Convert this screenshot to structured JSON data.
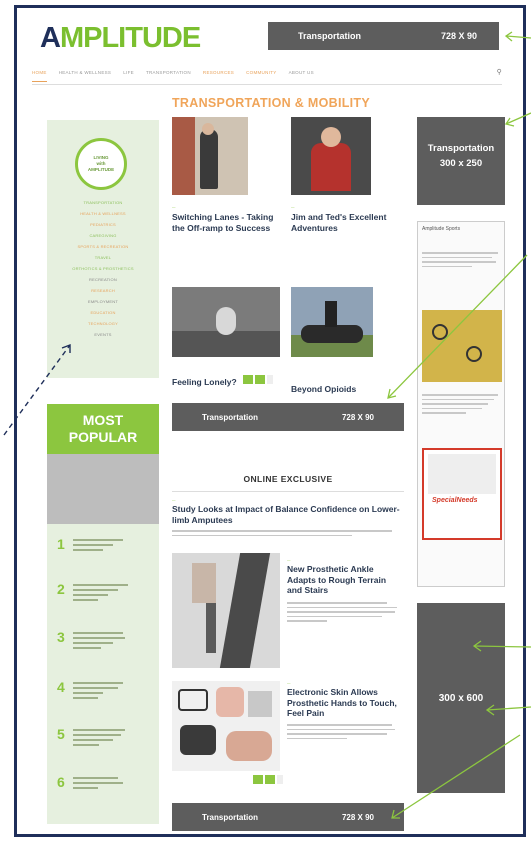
{
  "header": {
    "logo_prefix": "A",
    "logo_rest": "MPLITUDE",
    "ad_top": {
      "label": "Transportation",
      "size": "728 X 90"
    }
  },
  "nav": {
    "items": [
      "HOME",
      "HEALTH & WELLNESS",
      "LIFE",
      "TRANSPORTATION",
      "RESOURCES",
      "COMMUNITY",
      "ABOUT US"
    ],
    "search_icon": "search-icon"
  },
  "section_title": "TRANSPORTATION & MOBILITY",
  "side_menu": {
    "logo_text": [
      "LIVING",
      "with",
      "AMPLITUDE"
    ],
    "items": [
      "TRANSPORTATION",
      "HEALTH & WELLNESS",
      "PEDIATRICS",
      "CAREGIVING",
      "SPORTS & RECREATION",
      "TRAVEL",
      "ORTHOTICS & PROSTHETICS",
      "RECREATION",
      "RESEARCH",
      "EMPLOYMENT",
      "EDUCATION",
      "TECHNOLOGY",
      "EVENTS"
    ]
  },
  "most_popular": {
    "title_line1": "MOST",
    "title_line2": "POPULAR",
    "numbers": [
      "1",
      "2",
      "3",
      "4",
      "5",
      "6"
    ]
  },
  "posts": [
    {
      "title": "Switching Lanes - Taking the Off-ramp to Success"
    },
    {
      "title": "Jim and Ted's Excellent Adventures"
    },
    {
      "title": "Feeling Lonely?"
    },
    {
      "title": "Beyond Opioids"
    }
  ],
  "ad_mid": {
    "label": "Transportation",
    "size": "728 X 90"
  },
  "online_exclusive": {
    "heading": "ONLINE EXCLUSIVE",
    "lead_title": "Study Looks at Impact of Balance Confidence on Lower-limb Amputees",
    "items": [
      {
        "title": "New Prosthetic Ankle Adapts to Rough Terrain and Stairs"
      },
      {
        "title": "Electronic Skin Allows Prosthetic Hands to Touch, Feel Pain"
      }
    ]
  },
  "ad_bottom": {
    "label": "Transportation",
    "size": "728 X 90"
  },
  "right": {
    "ad1_line1": "Transportation",
    "ad1_line2": "300 x 250",
    "fb_title": "Amplitude Sports",
    "special_needs": "SpecialNeeds",
    "ad2": "300 x 600"
  },
  "colors": {
    "brand_green": "#8cc63f",
    "accent_orange": "#f0a55a",
    "ad_gray": "#5d5d5d",
    "frame_navy": "#1f2f5a"
  }
}
